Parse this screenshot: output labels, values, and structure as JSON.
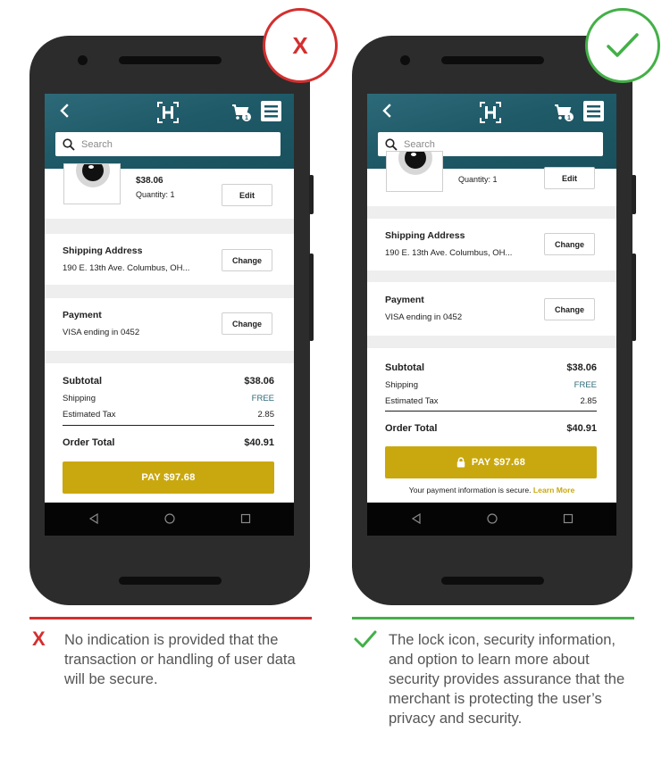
{
  "bad_example": {
    "badge": "X",
    "screen": {
      "search_placeholder": "Search",
      "product": {
        "price": "$38.06",
        "quantity": "Quantity: 1",
        "edit_label": "Edit"
      },
      "shipping": {
        "title": "Shipping Address",
        "address": "190 E. 13th Ave. Columbus, OH...",
        "change_label": "Change"
      },
      "payment": {
        "title": "Payment",
        "method": "VISA ending in 0452",
        "change_label": "Change"
      },
      "summary": {
        "subtotal_label": "Subtotal",
        "subtotal_value": "$38.06",
        "shipping_label": "Shipping",
        "shipping_value": "FREE",
        "tax_label": "Estimated Tax",
        "tax_value": "2.85",
        "total_label": "Order Total",
        "total_value": "$40.91"
      },
      "pay_button_label": "PAY $97.68",
      "cart_count": "1"
    },
    "caption": "No indication is provided that the transaction or handling of user data will be secure."
  },
  "good_example": {
    "screen": {
      "search_placeholder": "Search",
      "product": {
        "quantity": "Quantity: 1",
        "edit_label": "Edit"
      },
      "shipping": {
        "title": "Shipping Address",
        "address": "190 E. 13th Ave. Columbus, OH...",
        "change_label": "Change"
      },
      "payment": {
        "title": "Payment",
        "method": "VISA ending in 0452",
        "change_label": "Change"
      },
      "summary": {
        "subtotal_label": "Subtotal",
        "subtotal_value": "$38.06",
        "shipping_label": "Shipping",
        "shipping_value": "FREE",
        "tax_label": "Estimated Tax",
        "tax_value": "2.85",
        "total_label": "Order Total",
        "total_value": "$40.91"
      },
      "pay_button_label": "PAY $97.68",
      "secure_note": "Your payment information is secure.",
      "learn_more": "Learn More",
      "cart_count": "1"
    },
    "caption": "The lock icon, security information, and option to learn more about security provides assurance that the merchant is protecting the user’s privacy and security."
  },
  "colors": {
    "appbar": "#1f5a68",
    "pay_button": "#c9a80f",
    "bad_accent": "#d32f2f",
    "good_accent": "#43b047"
  },
  "icons": {
    "appbar": [
      "back-arrow-icon",
      "logo-h-icon",
      "cart-icon",
      "menu-icon",
      "search-icon"
    ],
    "navbar": [
      "nav-back-icon",
      "nav-home-icon",
      "nav-recent-icon"
    ],
    "badges": [
      "x-icon",
      "checkmark-icon"
    ],
    "pay": [
      "lock-icon"
    ]
  }
}
